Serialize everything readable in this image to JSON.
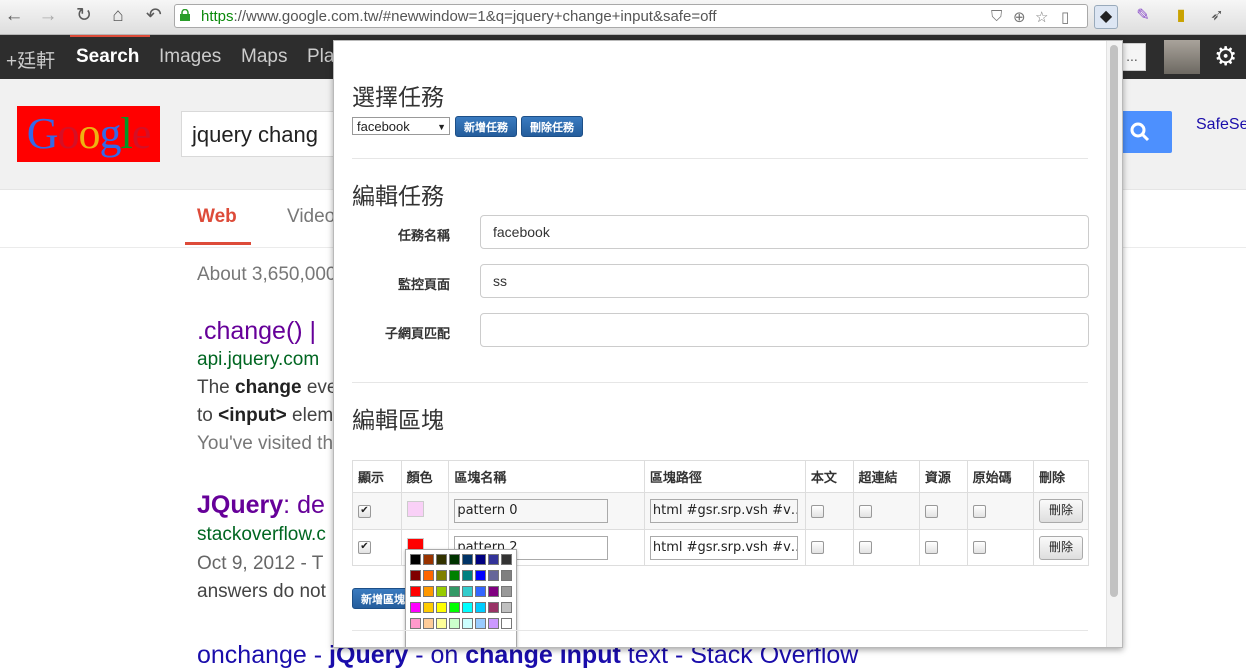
{
  "browser": {
    "url_scheme": "https",
    "url_rest": "://www.google.com.tw/#newwindow=1&q=jquery+change+input&safe=off"
  },
  "gbar": {
    "items": [
      "+廷軒",
      "Search",
      "Images",
      "Maps",
      "Pla"
    ],
    "more_button": "..."
  },
  "google": {
    "logo": "Google",
    "query": "jquery chang",
    "safesearch": "SafeSe",
    "tabs": [
      "Web",
      "Video"
    ],
    "stats": "About 3,650,000",
    "results": [
      {
        "title": ".change() |",
        "url": "api.jquery.com",
        "line1_pre": "The ",
        "line1_bold": "change",
        "line1_post": " eve",
        "line2_pre": "to ",
        "line2_bold": "<input>",
        "line2_post": " elem",
        "line3": "You've visited th"
      },
      {
        "title_bold": "JQuery",
        "title_rest": ": de",
        "url": "stackoverflow.c",
        "line1": "Oct 9, 2012 - T",
        "line2": "answers do not"
      }
    ],
    "bottom_result": {
      "p1": "onchange - ",
      "p2": "jQuery",
      "p3": " - on ",
      "p4": "change input",
      "p5": " text - Stack Overflow"
    }
  },
  "popup": {
    "select_task_heading": "選擇任務",
    "task_select_value": "facebook",
    "add_task_button": "新增任務",
    "delete_task_button": "刪除任務",
    "edit_task_heading": "編輯任務",
    "fields": {
      "task_name_label": "任務名稱",
      "task_name_value": "facebook",
      "monitor_page_label": "監控頁面",
      "monitor_page_value": "ss",
      "subpage_match_label": "子網頁匹配",
      "subpage_match_value": ""
    },
    "edit_block_heading": "編輯區塊",
    "table": {
      "headers": [
        "顯示",
        "顏色",
        "區塊名稱",
        "區塊路徑",
        "本文",
        "超連結",
        "資源",
        "原始碼",
        "刪除"
      ],
      "rows": [
        {
          "shown": true,
          "color": "#f9d0f7",
          "name": "pattern 0",
          "path": "html #gsr.srp.vsh #v…",
          "delete": "刪除"
        },
        {
          "shown": true,
          "color": "#ff0000",
          "name": "pattern 2",
          "path": "html #gsr.srp.vsh #v…",
          "delete": "刪除"
        }
      ]
    },
    "add_block_button": "新增區塊",
    "palette_colors": [
      "#000000",
      "#993300",
      "#333300",
      "#003300",
      "#003366",
      "#000080",
      "#333399",
      "#333333",
      "#800000",
      "#ff6600",
      "#808000",
      "#008000",
      "#008080",
      "#0000ff",
      "#666699",
      "#808080",
      "#ff0000",
      "#ff9900",
      "#99cc00",
      "#339966",
      "#33cccc",
      "#3366ff",
      "#800080",
      "#999999",
      "#ff00ff",
      "#ffcc00",
      "#ffff00",
      "#00ff00",
      "#00ffff",
      "#00ccff",
      "#993366",
      "#c0c0c0",
      "#ff99cc",
      "#ffcc99",
      "#ffff99",
      "#ccffcc",
      "#ccffff",
      "#99ccff",
      "#cc99ff",
      "#ffffff"
    ]
  }
}
